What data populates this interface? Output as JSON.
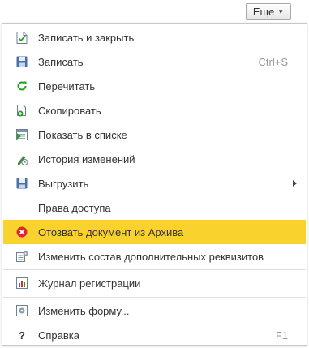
{
  "more_button": {
    "label": "Еще"
  },
  "menu": {
    "items": [
      {
        "label": "Записать и закрыть",
        "icon": "save-and-close-icon"
      },
      {
        "label": "Записать",
        "shortcut": "Ctrl+S",
        "icon": "floppy-disk-icon"
      },
      {
        "label": "Перечитать",
        "icon": "refresh-icon"
      },
      {
        "label": "Скопировать",
        "icon": "copy-document-icon"
      },
      {
        "label": "Показать в списке",
        "icon": "show-in-list-icon"
      },
      {
        "label": "История изменений",
        "icon": "history-icon"
      },
      {
        "label": "Выгрузить",
        "icon": "export-icon",
        "has_submenu": true
      },
      {
        "label": "Права доступа"
      },
      {
        "label": "Отозвать документ из Архива",
        "icon": "revoke-icon",
        "highlighted": true
      },
      {
        "label": "Изменить состав дополнительных реквизитов",
        "icon": "edit-attributes-icon"
      },
      {
        "label": "Журнал регистрации",
        "icon": "event-log-icon"
      },
      {
        "label": "Изменить форму...",
        "icon": "change-form-icon"
      },
      {
        "label": "Справка",
        "shortcut": "F1",
        "icon": "help-icon"
      }
    ]
  },
  "colors": {
    "highlight": "#f9d22e",
    "revoke_icon": "#d92b2b",
    "refresh_icon": "#2a9d2a",
    "save_icon": "#4a6fa5"
  }
}
